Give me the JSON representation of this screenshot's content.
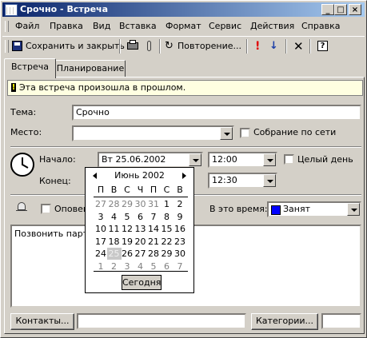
{
  "window": {
    "title": "Срочно - Встреча",
    "controls": [
      "_",
      "□",
      "×"
    ]
  },
  "menu": [
    "Файл",
    "Правка",
    "Вид",
    "Вставка",
    "Формат",
    "Сервис",
    "Действия",
    "Справка"
  ],
  "toolbar": {
    "save_close": "Сохранить и закрыть",
    "recurrence": "Повторение...",
    "help": "?"
  },
  "tabs": [
    "Встреча",
    "Планирование"
  ],
  "info": "Эта встреча произошла в прошлом.",
  "form": {
    "subject_label": "Тема:",
    "subject_value": "Срочно",
    "location_label": "Место:",
    "location_value": "",
    "online_label": "Собрание по сети",
    "start_label": "Начало:",
    "start_date": "Вт 25.06.2002",
    "start_time": "12:00",
    "allday_label": "Целый день",
    "end_label": "Конец:",
    "end_time": "12:30",
    "reminder_label": "Оповещ",
    "showas_label": "В это время:",
    "showas_value": "Занят",
    "showas_color": "#0000ff",
    "notes_text": "Позвонить парт"
  },
  "calendar": {
    "month_label": "Июнь 2002",
    "weekdays": [
      "П",
      "В",
      "С",
      "Ч",
      "П",
      "С",
      "В"
    ],
    "weeks": [
      [
        "27",
        "28",
        "29",
        "30",
        "31",
        "1",
        "2"
      ],
      [
        "3",
        "4",
        "5",
        "6",
        "7",
        "8",
        "9"
      ],
      [
        "10",
        "11",
        "12",
        "13",
        "14",
        "15",
        "16"
      ],
      [
        "17",
        "18",
        "19",
        "20",
        "21",
        "22",
        "23"
      ],
      [
        "24",
        "25",
        "26",
        "27",
        "28",
        "29",
        "30"
      ],
      [
        "1",
        "2",
        "3",
        "4",
        "5",
        "6",
        "7"
      ]
    ],
    "selected_day": "25",
    "today_label": "Сегодня"
  },
  "bottom": {
    "contacts_button": "Контакты...",
    "categories_button": "Категории..."
  }
}
